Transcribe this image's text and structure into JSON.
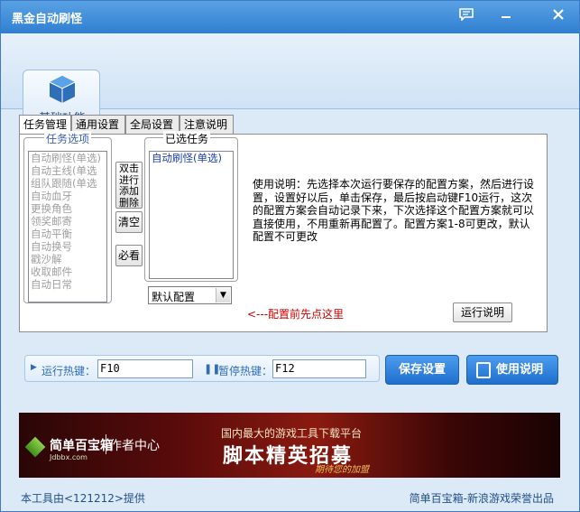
{
  "window": {
    "title": "黑金自动刷怪"
  },
  "header": {
    "tab_label": "基础功能"
  },
  "tabs": [
    {
      "label": "任务管理"
    },
    {
      "label": "通用设置"
    },
    {
      "label": "全局设置"
    },
    {
      "label": "注意说明"
    }
  ],
  "task_options": {
    "legend": "任务选项",
    "items": [
      "自动刷怪(单选)",
      "自动主线(单选",
      "组队跟随(单选",
      "自动血牙",
      "更换角色",
      "领奖邮寄",
      "自动平衡",
      "自动换号",
      "戳沙解",
      "收取邮件",
      "自动日常"
    ]
  },
  "side_buttons": {
    "action_label": "双击进行添加删除",
    "clear_label": "清空",
    "must_see_label": "必看"
  },
  "selected_tasks": {
    "legend": "已选任务",
    "items": [
      "自动刷怪(单选)"
    ]
  },
  "config_select": {
    "value": "默认配置"
  },
  "hint": "<---配置前先点这里",
  "description": "使用说明：先选择本次运行要保存的配置方案，然后进行设置，设置好以后，单击保存，最后按启动键F10运行，这次的配置方案会自动记录下来，下次选择这个配置方案就可以直接使用，不用重新再配置了。配置方案1-8可更改，默认配置不可更改",
  "run_help_button": "运行说明",
  "hotkeys": {
    "run_label": "运行热键：",
    "run_value": "F10",
    "pause_label": "暂停热键：",
    "pause_value": "F12"
  },
  "buttons": {
    "save": "保存设置",
    "manual": "使用说明"
  },
  "banner": {
    "logo_text": "简单百宝箱",
    "logo_sub": "Jdbbx.com",
    "author_center": "作者中心",
    "slogan": "国内最大的游戏工具下载平台",
    "headline": "脚本精英招募",
    "subline": "期待您的加盟"
  },
  "footer": {
    "left": "本工具由<121212>提供",
    "right": "简单百宝箱-新浪游戏荣誉出品"
  }
}
